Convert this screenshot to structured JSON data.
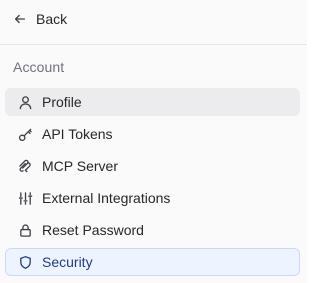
{
  "back": {
    "label": "Back"
  },
  "section": {
    "title": "Account"
  },
  "nav": {
    "items": [
      {
        "label": "Profile",
        "icon": "user-icon",
        "state": "hover"
      },
      {
        "label": "API Tokens",
        "icon": "key-icon",
        "state": ""
      },
      {
        "label": "MCP Server",
        "icon": "mcp-icon",
        "state": ""
      },
      {
        "label": "External Integrations",
        "icon": "sliders-icon",
        "state": ""
      },
      {
        "label": "Reset Password",
        "icon": "lock-icon",
        "state": ""
      },
      {
        "label": "Security",
        "icon": "shield-icon",
        "state": "active"
      }
    ]
  },
  "colors": {
    "accent": "#1e3a8a",
    "active_bg": "#eef4ff",
    "hover_bg": "#ececee"
  }
}
